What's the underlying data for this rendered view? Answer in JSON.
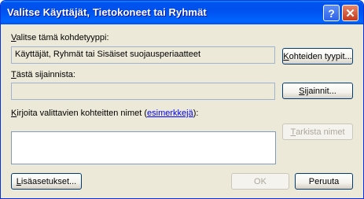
{
  "window": {
    "title": "Valitse Käyttäjät, Tietokoneet tai Ryhmät"
  },
  "titlebar": {
    "help_glyph": "?",
    "close_glyph": "✕"
  },
  "object_type": {
    "label_accel": "V",
    "label_rest": "alitse tämä kohdetyyppi:",
    "value": "Käyttäjät, Ryhmät tai Sisäiset suojausperiaatteet",
    "button_accel": "K",
    "button_rest": "ohteiden tyypit..."
  },
  "location": {
    "label_accel": "T",
    "label_rest": "ästä sijainnista:",
    "value": "",
    "button_accel": "S",
    "button_rest": "ijainnit..."
  },
  "names": {
    "label_accel": "K",
    "label_pre": "irjoita valittavien kohteitten nimet (",
    "link": "esimerkkejä",
    "label_post": "):",
    "check_accel": "T",
    "check_rest": "arkista nimet"
  },
  "footer": {
    "advanced_accel": "L",
    "advanced_rest": "isäasetukset...",
    "ok": "OK",
    "cancel": "Peruuta"
  }
}
